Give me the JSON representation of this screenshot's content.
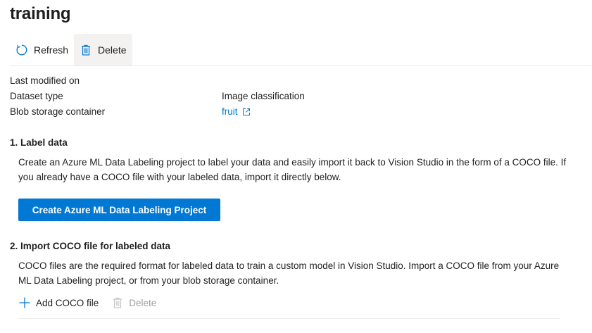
{
  "page": {
    "title": "training"
  },
  "toolbar": {
    "refresh_label": "Refresh",
    "delete_label": "Delete",
    "refresh_icon": "refresh-icon",
    "delete_icon": "trash-icon"
  },
  "properties": [
    {
      "label": "Last modified on",
      "value": ""
    },
    {
      "label": "Dataset type",
      "value": "Image classification"
    },
    {
      "label": "Blob storage container",
      "value": "fruit",
      "is_link": true,
      "icon": "open-in-new-window-icon"
    }
  ],
  "section1": {
    "title": "1. Label data",
    "description": "Create an Azure ML Data Labeling project to label your data and easily import it back to Vision Studio in the form of a COCO file. If you already have a COCO file with your labeled data, import it directly below.",
    "button_label": "Create Azure ML Data Labeling Project"
  },
  "section2": {
    "title": "2. Import COCO file for labeled data",
    "description": "COCO files are the required format for labeled data to train a custom model in Vision Studio. Import a COCO file from your Azure ML Data Labeling project, or from your blob storage container.",
    "add_label": "Add COCO file",
    "delete_label": "Delete",
    "add_icon": "plus-icon",
    "delete_icon": "trash-icon",
    "delete_disabled": true
  },
  "colors": {
    "accent": "#0078d4",
    "text": "#201f1e",
    "disabled": "#a19f9d",
    "divider": "#edebe9",
    "hover": "#f3f2f1"
  }
}
